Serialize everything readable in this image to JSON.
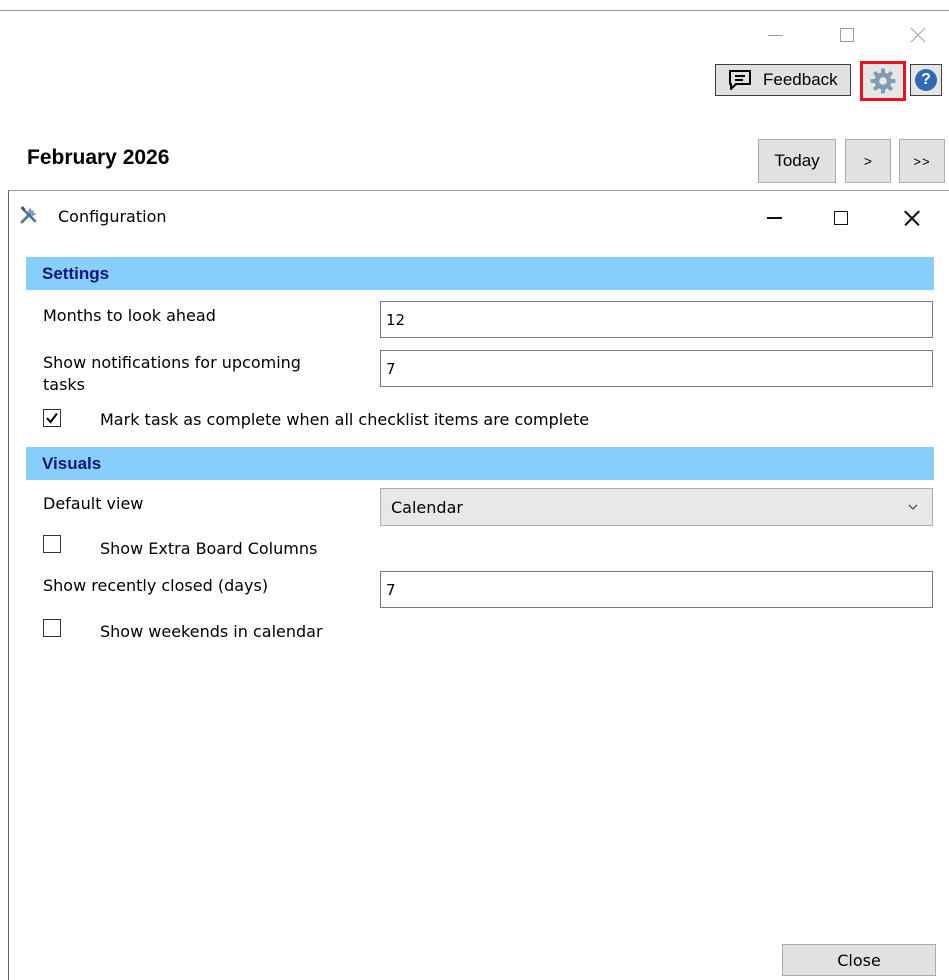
{
  "toolbar": {
    "feedback_label": "Feedback",
    "help_glyph": "?"
  },
  "calendar": {
    "month_title": "February 2026",
    "today_label": "Today",
    "next_label": ">",
    "next_next_label": ">>"
  },
  "dialog": {
    "title": "Configuration",
    "settings": {
      "header": "Settings",
      "months_ahead_label": "Months to look ahead",
      "months_ahead_value": "12",
      "notifications_label_line1": "Show notifications for upcoming",
      "notifications_label_line2": "tasks",
      "notifications_value": "7",
      "mark_complete_label": "Mark task as complete when all checklist items are complete",
      "mark_complete_checked": true
    },
    "visuals": {
      "header": "Visuals",
      "default_view_label": "Default view",
      "default_view_value": "Calendar",
      "extra_columns_label": "Show Extra Board Columns",
      "extra_columns_checked": false,
      "recently_closed_label": "Show recently closed (days)",
      "recently_closed_value": "7",
      "weekends_label": "Show weekends in calendar",
      "weekends_checked": false
    },
    "close_label": "Close"
  },
  "icons": {
    "window_controls": [
      "minimize-icon",
      "maximize-icon",
      "close-icon"
    ],
    "toolbar": [
      "feedback-icon",
      "gear-icon",
      "help-icon"
    ],
    "dialog_title": "tools-icon"
  },
  "colors": {
    "section_bar": "#87cefa",
    "section_text": "#14147a",
    "highlight_border": "#e81123",
    "help_blue": "#2f6ab3",
    "button_face": "#e1e1e1"
  }
}
